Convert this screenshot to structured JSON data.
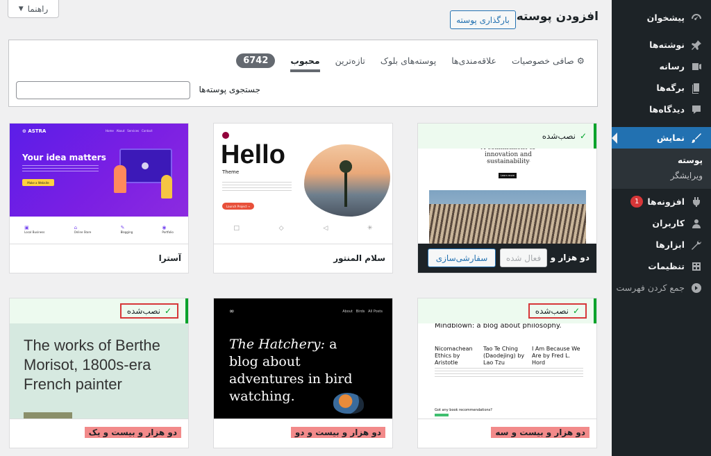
{
  "help_label": "راهنما",
  "page_title": "افزودن پوسته‌ها",
  "upload_button": "بارگذاری پوسته",
  "filter": {
    "count": "6742",
    "tabs": [
      "محبوب",
      "تازه‌ترین",
      "پوسته‌های بلوک",
      "علاقه‌مندی‌ها",
      "صافی خصوصیات"
    ],
    "search_label": "جستجوی پوسته‌ها",
    "search_value": ""
  },
  "sidebar": {
    "items": [
      {
        "label": "پیشخوان",
        "icon": "dashboard-icon"
      },
      {
        "label": "نوشته‌ها",
        "icon": "pin-icon"
      },
      {
        "label": "رسانه",
        "icon": "media-icon"
      },
      {
        "label": "برگه‌ها",
        "icon": "pages-icon"
      },
      {
        "label": "دیدگاه‌ها",
        "icon": "comments-icon"
      },
      {
        "label": "نمایش",
        "icon": "brush-icon"
      }
    ],
    "sub_items": [
      "پوسته",
      "ویرایشگر"
    ],
    "items2": [
      {
        "label": "افزونه‌ها",
        "icon": "plugin-icon",
        "badge": "1"
      },
      {
        "label": "کاربران",
        "icon": "users-icon"
      },
      {
        "label": "ابزارها",
        "icon": "tools-icon"
      },
      {
        "label": "تنظیمات",
        "icon": "settings-icon"
      }
    ],
    "collapse": "جمع کردن فهرست"
  },
  "cards": [
    {
      "name": "دو هزار و بیست و سه",
      "installed": "نصب‌شده",
      "activate": "فعال شده",
      "customize": "سفارشی‌سازی",
      "preview": {
        "tagline": "A commitment to innovation and sustainability",
        "button": "Learn more"
      }
    },
    {
      "name": "سلام المنتور",
      "preview": {
        "heading": "Hello",
        "sub": "Theme",
        "button": "Launch Project →"
      }
    },
    {
      "name": "آسترا",
      "preview": {
        "brand": "ASTRA",
        "heading": "Your idea matters",
        "button": "Make a Website",
        "features": [
          "Local Business",
          "Online Store",
          "Blogging",
          "Portfolio"
        ]
      }
    },
    {
      "name": "دو هزار و بیست و سه",
      "installed": "نصب‌شده",
      "preview": {
        "heading": "Mindblown: a blog about philosophy.",
        "posts": [
          "Nicomachean Ethics by Aristotle",
          "Tao Te Ching (Daodejing) by Lao Tzu",
          "I Am Because We Are by Fred L. Hord"
        ],
        "footer": "Got any book recommendations?"
      }
    },
    {
      "name": "دو هزار و بیست و دو",
      "preview": {
        "heading_em": "The Hatchery:",
        "heading": "a blog about adventures in bird watching.",
        "nav": [
          "About",
          "Birds",
          "All Posts"
        ]
      }
    },
    {
      "name": "دو هزار و بیست و یک",
      "installed": "نصب‌شده",
      "preview": {
        "heading": "The works of Berthe Morisot, 1800s-era French painter"
      }
    }
  ]
}
